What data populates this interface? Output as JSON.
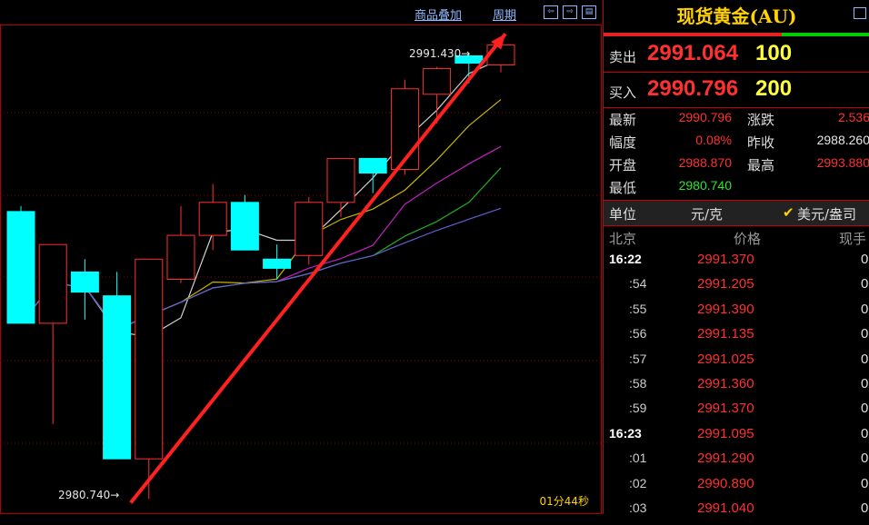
{
  "toolbar": {
    "overlay_label": "商品叠加",
    "period_label": "周期"
  },
  "chart": {
    "high_label": "2991.430→",
    "low_label": "2980.740→",
    "timer": "01分44秒",
    "colors": {
      "up": "#ff3030",
      "down": "#00ffff",
      "trend_arrow": "#ff2020"
    },
    "candles": [
      {
        "o": 2988.85,
        "h": 2989.0,
        "l": 2985.8,
        "c": 2985.8,
        "dir": "down"
      },
      {
        "o": 2985.8,
        "h": 2987.95,
        "l": 2983.05,
        "c": 2987.95,
        "dir": "up"
      },
      {
        "o": 2987.2,
        "h": 2987.55,
        "l": 2985.9,
        "c": 2986.65,
        "dir": "down"
      },
      {
        "o": 2986.55,
        "h": 2987.2,
        "l": 2982.1,
        "c": 2982.1,
        "dir": "down"
      },
      {
        "o": 2982.1,
        "h": 2987.55,
        "l": 2981.0,
        "c": 2987.55,
        "dir": "up"
      },
      {
        "o": 2987.0,
        "h": 2989.0,
        "l": 2986.9,
        "c": 2988.2,
        "dir": "up"
      },
      {
        "o": 2988.2,
        "h": 2989.6,
        "l": 2987.8,
        "c": 2989.1,
        "dir": "up"
      },
      {
        "o": 2989.1,
        "h": 2989.3,
        "l": 2987.8,
        "c": 2987.8,
        "dir": "down"
      },
      {
        "o": 2987.55,
        "h": 2987.95,
        "l": 2987.0,
        "c": 2987.3,
        "dir": "down"
      },
      {
        "o": 2987.65,
        "h": 2989.25,
        "l": 2987.4,
        "c": 2989.1,
        "dir": "up"
      },
      {
        "o": 2989.1,
        "h": 2990.3,
        "l": 2988.7,
        "c": 2990.3,
        "dir": "up"
      },
      {
        "o": 2990.3,
        "h": 2990.3,
        "l": 2989.35,
        "c": 2989.9,
        "dir": "down"
      },
      {
        "o": 2990.0,
        "h": 2992.45,
        "l": 2989.85,
        "c": 2992.2,
        "dir": "up"
      },
      {
        "o": 2992.05,
        "h": 2992.8,
        "l": 2991.25,
        "c": 2992.75,
        "dir": "up"
      },
      {
        "o": 2993.1,
        "h": 2993.15,
        "l": 2992.35,
        "c": 2992.9,
        "dir": "down"
      },
      {
        "o": 2992.85,
        "h": 2993.6,
        "l": 2992.65,
        "c": 2993.4,
        "dir": "up"
      }
    ]
  },
  "quote": {
    "title": "现货黄金(AU)",
    "ask_label": "卖出",
    "ask_price": "2991.064",
    "ask_vol": "100",
    "bid_label": "买入",
    "bid_price": "2990.796",
    "bid_vol": "200",
    "ratio_red": 0.67,
    "stats": [
      {
        "l1": "最新",
        "v1": "2990.796",
        "c1": "#ff3030",
        "l2": "涨跌",
        "v2": "2.536",
        "c2": "#ff3030"
      },
      {
        "l1": "幅度",
        "v1": "0.08%",
        "c1": "#ff3030",
        "l2": "昨收",
        "v2": "2988.260",
        "c2": "#e6e6e6"
      },
      {
        "l1": "开盘",
        "v1": "2988.870",
        "c1": "#ff3030",
        "l2": "最高",
        "v2": "2993.880",
        "c2": "#ff3030"
      },
      {
        "l1": "最低",
        "v1": "2980.740",
        "c1": "#2ee62e",
        "l2": "",
        "v2": "",
        "c2": "#e6e6e6"
      }
    ],
    "unit_label": "单位",
    "unit_cny": "元/克",
    "unit_usd": "美元/盎司",
    "tick_headers": [
      "北京",
      "价格",
      "现手"
    ],
    "ticks": [
      {
        "t": "16:22",
        "p": "2991.370",
        "v": "0",
        "major": true
      },
      {
        "t": ":54",
        "p": "2991.205",
        "v": "0",
        "major": false
      },
      {
        "t": ":55",
        "p": "2991.390",
        "v": "0",
        "major": false
      },
      {
        "t": ":56",
        "p": "2991.135",
        "v": "0",
        "major": false
      },
      {
        "t": ":57",
        "p": "2991.025",
        "v": "0",
        "major": false
      },
      {
        "t": ":58",
        "p": "2991.360",
        "v": "0",
        "major": false
      },
      {
        "t": ":59",
        "p": "2991.370",
        "v": "0",
        "major": false
      },
      {
        "t": "16:23",
        "p": "2991.095",
        "v": "0",
        "major": true
      },
      {
        "t": ":01",
        "p": "2991.290",
        "v": "0",
        "major": false
      },
      {
        "t": ":02",
        "p": "2990.890",
        "v": "0",
        "major": false
      },
      {
        "t": ":03",
        "p": "2991.040",
        "v": "0",
        "major": false
      }
    ]
  }
}
